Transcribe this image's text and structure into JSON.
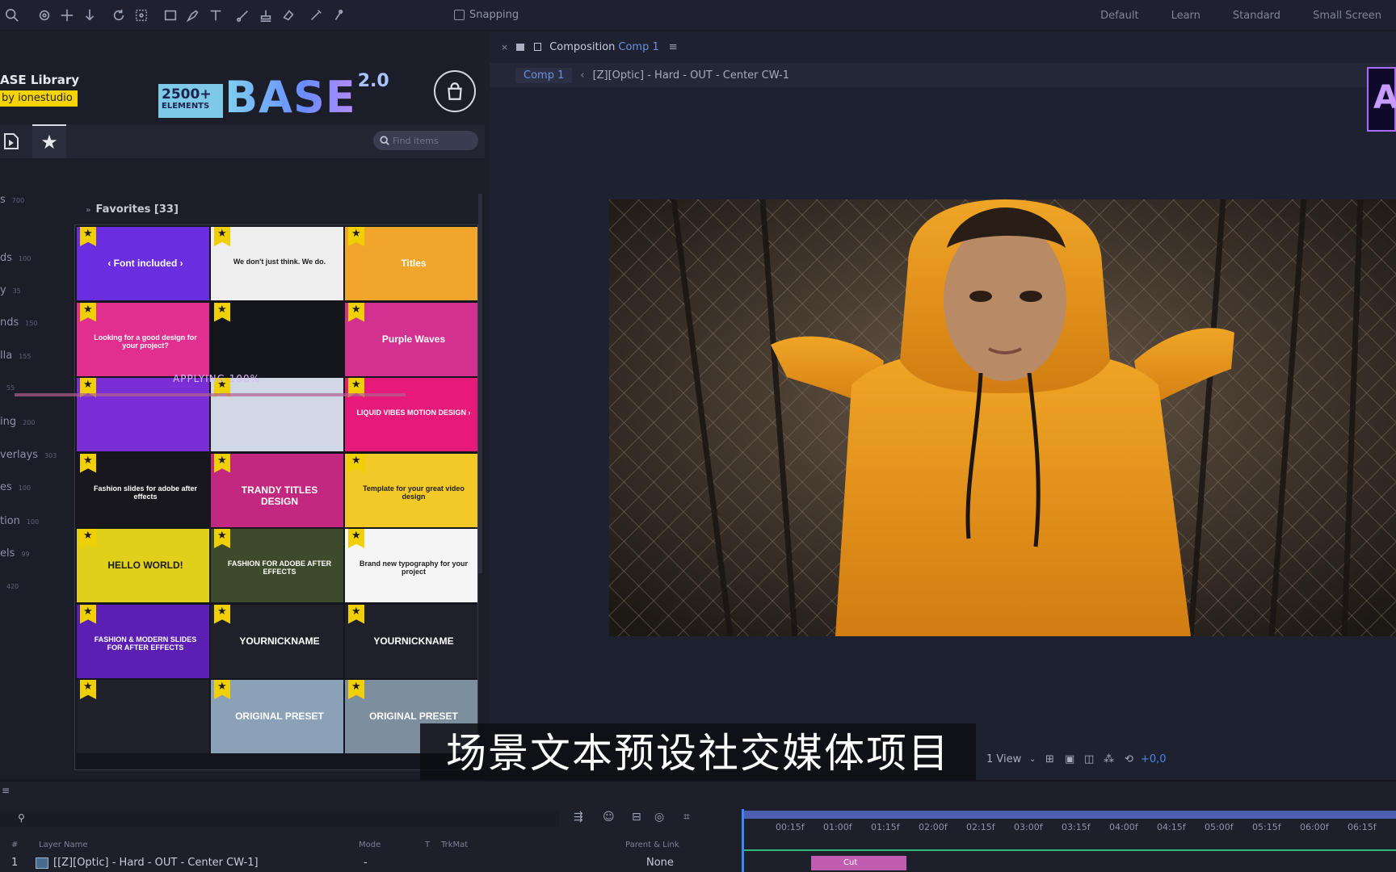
{
  "toolbar": {
    "snapping_label": "Snapping",
    "workspaces": [
      "Default",
      "Learn",
      "Standard",
      "Small Screen"
    ]
  },
  "base_panel": {
    "library_title": "ASE Library",
    "library_by": "by ionestudio",
    "logo_small_top": "2500+",
    "logo_small_bottom": "ELEMENTS",
    "logo_name": "BASE",
    "logo_version": "2.0",
    "search_placeholder": "Find items",
    "favorites_header": "Favorites [33]",
    "applying_text": "APPLYING 100%",
    "categories": [
      {
        "label": "s",
        "count": "700"
      },
      {
        "label": "ds",
        "count": "100"
      },
      {
        "label": "y",
        "count": "35"
      },
      {
        "label": "nds",
        "count": "150"
      },
      {
        "label": "lla",
        "count": "155"
      },
      {
        "label": "",
        "count": "55"
      },
      {
        "label": "ing",
        "count": "200"
      },
      {
        "label": "verlays",
        "count": "303"
      },
      {
        "label": "es",
        "count": "100"
      },
      {
        "label": "tion",
        "count": "100"
      },
      {
        "label": "els",
        "count": "99"
      },
      {
        "label": "",
        "count": "420"
      }
    ],
    "tiles": [
      {
        "text": "‹ Font included ›",
        "bg": "#6a2ee0"
      },
      {
        "text": "We don't just think. We do.",
        "bg": "#eeeeee"
      },
      {
        "text": "Titles",
        "bg": "#f1a52a"
      },
      {
        "text": "Looking for a good design for your project?",
        "bg": "#e12f8f"
      },
      {
        "text": "",
        "bg": "#15151c"
      },
      {
        "text": "Purple Waves",
        "bg": "#d3318f"
      },
      {
        "text": "",
        "bg": "#7a2fd6"
      },
      {
        "text": "",
        "bg": "#cfd8e4"
      },
      {
        "text": "LIQUID VIBES MOTION DESIGN ›",
        "bg": "#e61a7a"
      },
      {
        "text": "Fashion slides for adobe after effects",
        "bg": "#17171d"
      },
      {
        "text": "TRANDY TITLES DESIGN",
        "bg": "#c2287f"
      },
      {
        "text": "Template for your great video design",
        "bg": "#f3c928"
      },
      {
        "text": "HELLO WORLD!",
        "bg": "#e0cf1b"
      },
      {
        "text": "FASHION FOR ADOBE AFTER EFFECTS",
        "bg": "#3e4a2c"
      },
      {
        "text": "Brand new typography for your project",
        "bg": "#f5f5f5"
      },
      {
        "text": "FASHION & MODERN SLIDES FOR AFTER EFFECTS",
        "bg": "#5b1fb4"
      },
      {
        "text": "YOURNICKNAME",
        "bg": "#1f2029"
      },
      {
        "text": "YOURNICKNAME",
        "bg": "#1f2029"
      },
      {
        "text": "",
        "bg": "#202129"
      },
      {
        "text": "ORIGINAL   PRESET",
        "bg": "#8aa1b8"
      },
      {
        "text": "ORIGINAL   PRESET",
        "bg": "#7d8e9e"
      }
    ]
  },
  "composition": {
    "header_prefix": "Composition",
    "header_name": "Comp 1",
    "crumb_comp": "Comp 1",
    "crumb_layer": "[Z][Optic] - Hard - OUT - Center CW-1",
    "view_label": "1 View",
    "offset_label": "+0,0"
  },
  "subtitle": "场景文本预设社交媒体项目",
  "timeline": {
    "col_num": "#",
    "col_layer_name": "Layer Name",
    "col_mode": "Mode",
    "col_t": "T",
    "col_trkmat": "TrkMat",
    "col_parent": "Parent & Link",
    "layer_index": "1",
    "layer_name": "[[Z][Optic] - Hard - OUT - Center CW-1]",
    "layer_mode": "-",
    "layer_parent": "None",
    "clip_label": "Cut",
    "ruler_ticks": [
      "00:15f",
      "01:00f",
      "01:15f",
      "02:00f",
      "02:15f",
      "03:00f",
      "03:15f",
      "04:00f",
      "04:15f",
      "05:00f",
      "05:15f",
      "06:00f",
      "06:15f"
    ]
  }
}
